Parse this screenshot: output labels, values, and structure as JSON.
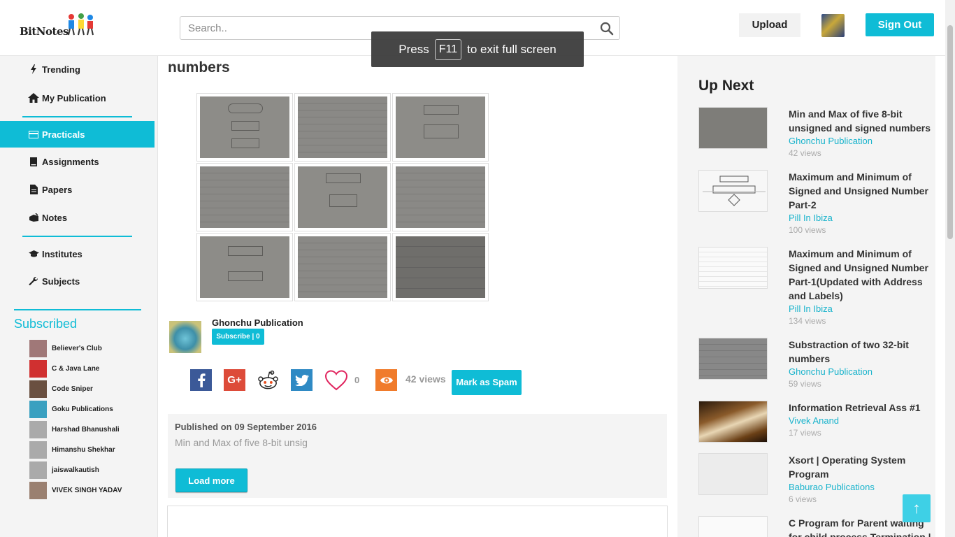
{
  "header": {
    "logo_text": "BitNotes",
    "search_placeholder": "Search..",
    "upload_label": "Upload",
    "signout_label": "Sign Out"
  },
  "fullscreen_toast": {
    "prefix": "Press",
    "key": "F11",
    "suffix": "to exit full screen"
  },
  "sidebar": {
    "items": [
      {
        "label": "Trending",
        "icon": "bolt-icon"
      },
      {
        "label": "My Publication",
        "icon": "home-icon"
      },
      {
        "label": "Practicals",
        "icon": "card-icon",
        "active": true
      },
      {
        "label": "Assignments",
        "icon": "book-icon"
      },
      {
        "label": "Papers",
        "icon": "file-icon"
      },
      {
        "label": "Notes",
        "icon": "notes-icon"
      },
      {
        "label": "Institutes",
        "icon": "graduation-cap-icon"
      },
      {
        "label": "Subjects",
        "icon": "wrench-icon"
      }
    ],
    "subscribed_title": "Subscribed",
    "subscribed": [
      {
        "name": "Believer's Club",
        "color": "#a07878"
      },
      {
        "name": "C & Java Lane",
        "color": "#d03030"
      },
      {
        "name": "Code Sniper",
        "color": "#6a5040"
      },
      {
        "name": "Goku Publications",
        "color": "#3aa0c0"
      },
      {
        "name": "Harshad Bhanushali",
        "color": "#aaaaaa"
      },
      {
        "name": "Himanshu Shekhar",
        "color": "#aaaaaa"
      },
      {
        "name": "jaiswalkautish",
        "color": "#aaaaaa"
      },
      {
        "name": "VIVEK SINGH YADAV",
        "color": "#9a8070"
      }
    ]
  },
  "main": {
    "title": "numbers",
    "publisher": {
      "name": "Ghonchu Publication",
      "subscribe_label": "Subscribe | 0"
    },
    "likes": "0",
    "views": "42 views",
    "spam_label": "Mark as Spam",
    "published_on": "Published on 09 September 2016",
    "description": "Min and Max of five 8-bit unsig",
    "load_more_label": "Load more"
  },
  "upnext": {
    "title": "Up Next",
    "items": [
      {
        "title": "Min and Max of five 8-bit unsigned and signed numbers",
        "publisher": "Ghonchu Publication",
        "views": "42 views",
        "thumb": "dark"
      },
      {
        "title": "Maximum and Minimum of Signed and Unsigned Number Part-2",
        "publisher": "Pill In Ibiza",
        "views": "100 views",
        "thumb": "white-diagram"
      },
      {
        "title": "Maximum and Minimum of Signed and Unsigned Number Part-1(Updated with Address and Labels)",
        "publisher": "Pill In Ibiza",
        "views": "134 views",
        "thumb": "white-table"
      },
      {
        "title": "Substraction of two 32-bit numbers",
        "publisher": "Ghonchu Publication",
        "views": "59 views",
        "thumb": "dark"
      },
      {
        "title": "Information Retrieval Ass #1",
        "publisher": "Vivek Anand",
        "views": "17 views",
        "thumb": "books"
      },
      {
        "title": "Xsort | Operating System Program",
        "publisher": "Baburao Publications",
        "views": "6 views",
        "thumb": "blank"
      },
      {
        "title": "C Program for Parent waiting for child process Termination |",
        "publisher": "",
        "views": "",
        "thumb": "white-table"
      }
    ]
  },
  "scroll_top_label": "↑"
}
